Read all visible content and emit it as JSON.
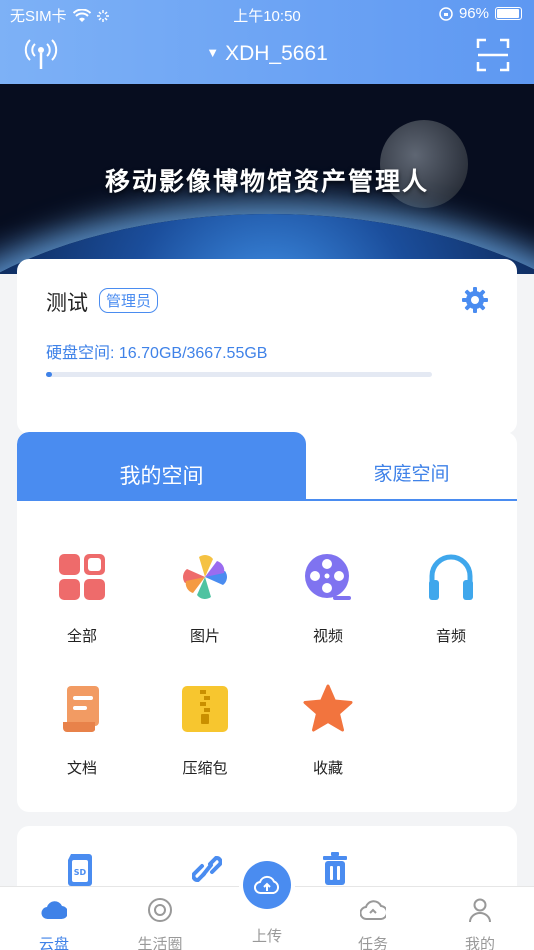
{
  "status_bar": {
    "carrier": "无SIM卡",
    "time": "上午10:50",
    "battery": "96%"
  },
  "header": {
    "device_name": "XDH_5661"
  },
  "banner": {
    "title": "移动影像博物馆资产管理人"
  },
  "info": {
    "user_name": "测试",
    "role": "管理员",
    "disk_label": "硬盘空间:",
    "disk_used": "16.70GB/3667.55GB",
    "disk_fraction": 0.0046
  },
  "tabs": {
    "my_space": "我的空间",
    "family_space": "家庭空间"
  },
  "categories": [
    {
      "label": "全部",
      "icon": "grid-all-icon"
    },
    {
      "label": "图片",
      "icon": "pinwheel-photo-icon"
    },
    {
      "label": "视频",
      "icon": "film-reel-icon"
    },
    {
      "label": "音频",
      "icon": "headphones-icon"
    },
    {
      "label": "文档",
      "icon": "scroll-document-icon"
    },
    {
      "label": "压缩包",
      "icon": "zip-archive-icon"
    },
    {
      "label": "收藏",
      "icon": "star-icon"
    }
  ],
  "bottom_nav": [
    {
      "label": "云盘",
      "icon": "cloud-icon",
      "active": true
    },
    {
      "label": "生活圈",
      "icon": "circle-icon",
      "active": false
    },
    {
      "label": "上传",
      "icon": "upload-cloud-icon",
      "active": false
    },
    {
      "label": "任务",
      "icon": "task-cloud-icon",
      "active": false
    },
    {
      "label": "我的",
      "icon": "person-icon",
      "active": false
    }
  ],
  "colors": {
    "accent": "#4a8cf0",
    "header_gradient_start": "#7db1f6",
    "header_gradient_end": "#5e98f2"
  }
}
